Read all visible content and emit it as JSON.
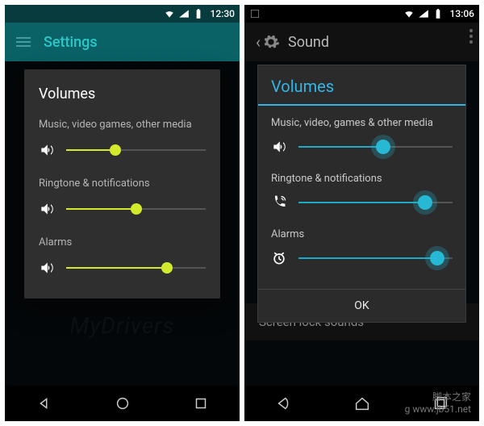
{
  "left": {
    "status": {
      "time": "12:30"
    },
    "appbar": {
      "title": "Settings"
    },
    "dialog": {
      "title": "Volumes",
      "groups": [
        {
          "label": "Music, video games, other media",
          "icon": "volume-icon",
          "value": 35
        },
        {
          "label": "Ringtone & notifications",
          "icon": "volume-icon",
          "value": 50
        },
        {
          "label": "Alarms",
          "icon": "volume-icon",
          "value": 72
        }
      ]
    },
    "accent": "#d3ea2c"
  },
  "right": {
    "status": {
      "time": "13:06"
    },
    "appbar": {
      "title": "Sound"
    },
    "dialog": {
      "title": "Volumes",
      "groups": [
        {
          "label": "Music, video, games & other media",
          "icon": "volume-icon",
          "value": 55
        },
        {
          "label": "Ringtone & notifications",
          "icon": "phone-ring-icon",
          "value": 82
        },
        {
          "label": "Alarms",
          "icon": "alarm-icon",
          "value": 90
        }
      ],
      "ok": "OK"
    },
    "below_item": "Screen lock sounds",
    "accent": "#33b5e5"
  },
  "watermark": {
    "left": "MyDrivers",
    "right_cn": "脚本之家",
    "right_url": "g www.jb51.net"
  }
}
